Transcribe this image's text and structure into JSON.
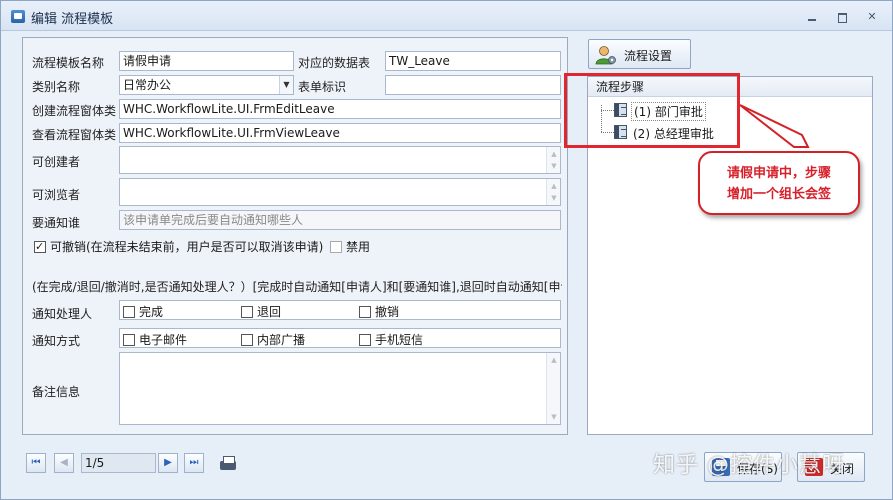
{
  "window": {
    "title": "编辑 流程模板"
  },
  "form": {
    "template_name_label": "流程模板名称",
    "template_name_value": "请假申请",
    "table_label": "对应的数据表",
    "table_value": "TW_Leave",
    "category_label": "类别名称",
    "category_value": "日常办公",
    "form_id_label": "表单标识",
    "form_id_value": "",
    "create_form_label": "创建流程窗体类",
    "create_form_value": "WHC.WorkflowLite.UI.FrmEditLeave",
    "view_form_label": "查看流程窗体类",
    "view_form_value": "WHC.WorkflowLite.UI.FrmViewLeave",
    "can_create_label": "可创建者",
    "can_view_label": "可浏览者",
    "notify_label": "要通知谁",
    "notify_placeholder": "该申请单完成后要自动通知哪些人",
    "revocable_label": "可撤销(在流程未结束前，用户是否可以取消该申请)",
    "revocable_checked": true,
    "disabled_label": "禁用",
    "disabled_checked": false,
    "info_text": "(在完成/退回/撤消时,是否通知处理人？）[完成时自动通知[申请人]和[要通知谁],退回时自动通知[申请",
    "notify_handler_label": "通知处理人",
    "notify_handler_options": [
      "完成",
      "退回",
      "撤销"
    ],
    "notify_method_label": "通知方式",
    "notify_method_options": [
      "电子邮件",
      "内部广播",
      "手机短信"
    ],
    "remarks_label": "备注信息"
  },
  "right_panel": {
    "flow_settings_button": "流程设置",
    "steps_header": "流程步骤",
    "steps": [
      "(1) 部门审批",
      "(2) 总经理审批"
    ]
  },
  "annotation": {
    "callout_text": "请假申请中，步骤\n增加一个组长会签",
    "color": "#d8202a"
  },
  "navigation": {
    "page_value": "1/5"
  },
  "buttons": {
    "save_label": "保存(S)",
    "close_label": "关闭"
  },
  "watermark": {
    "text": "知乎 @控件小慧呀"
  }
}
